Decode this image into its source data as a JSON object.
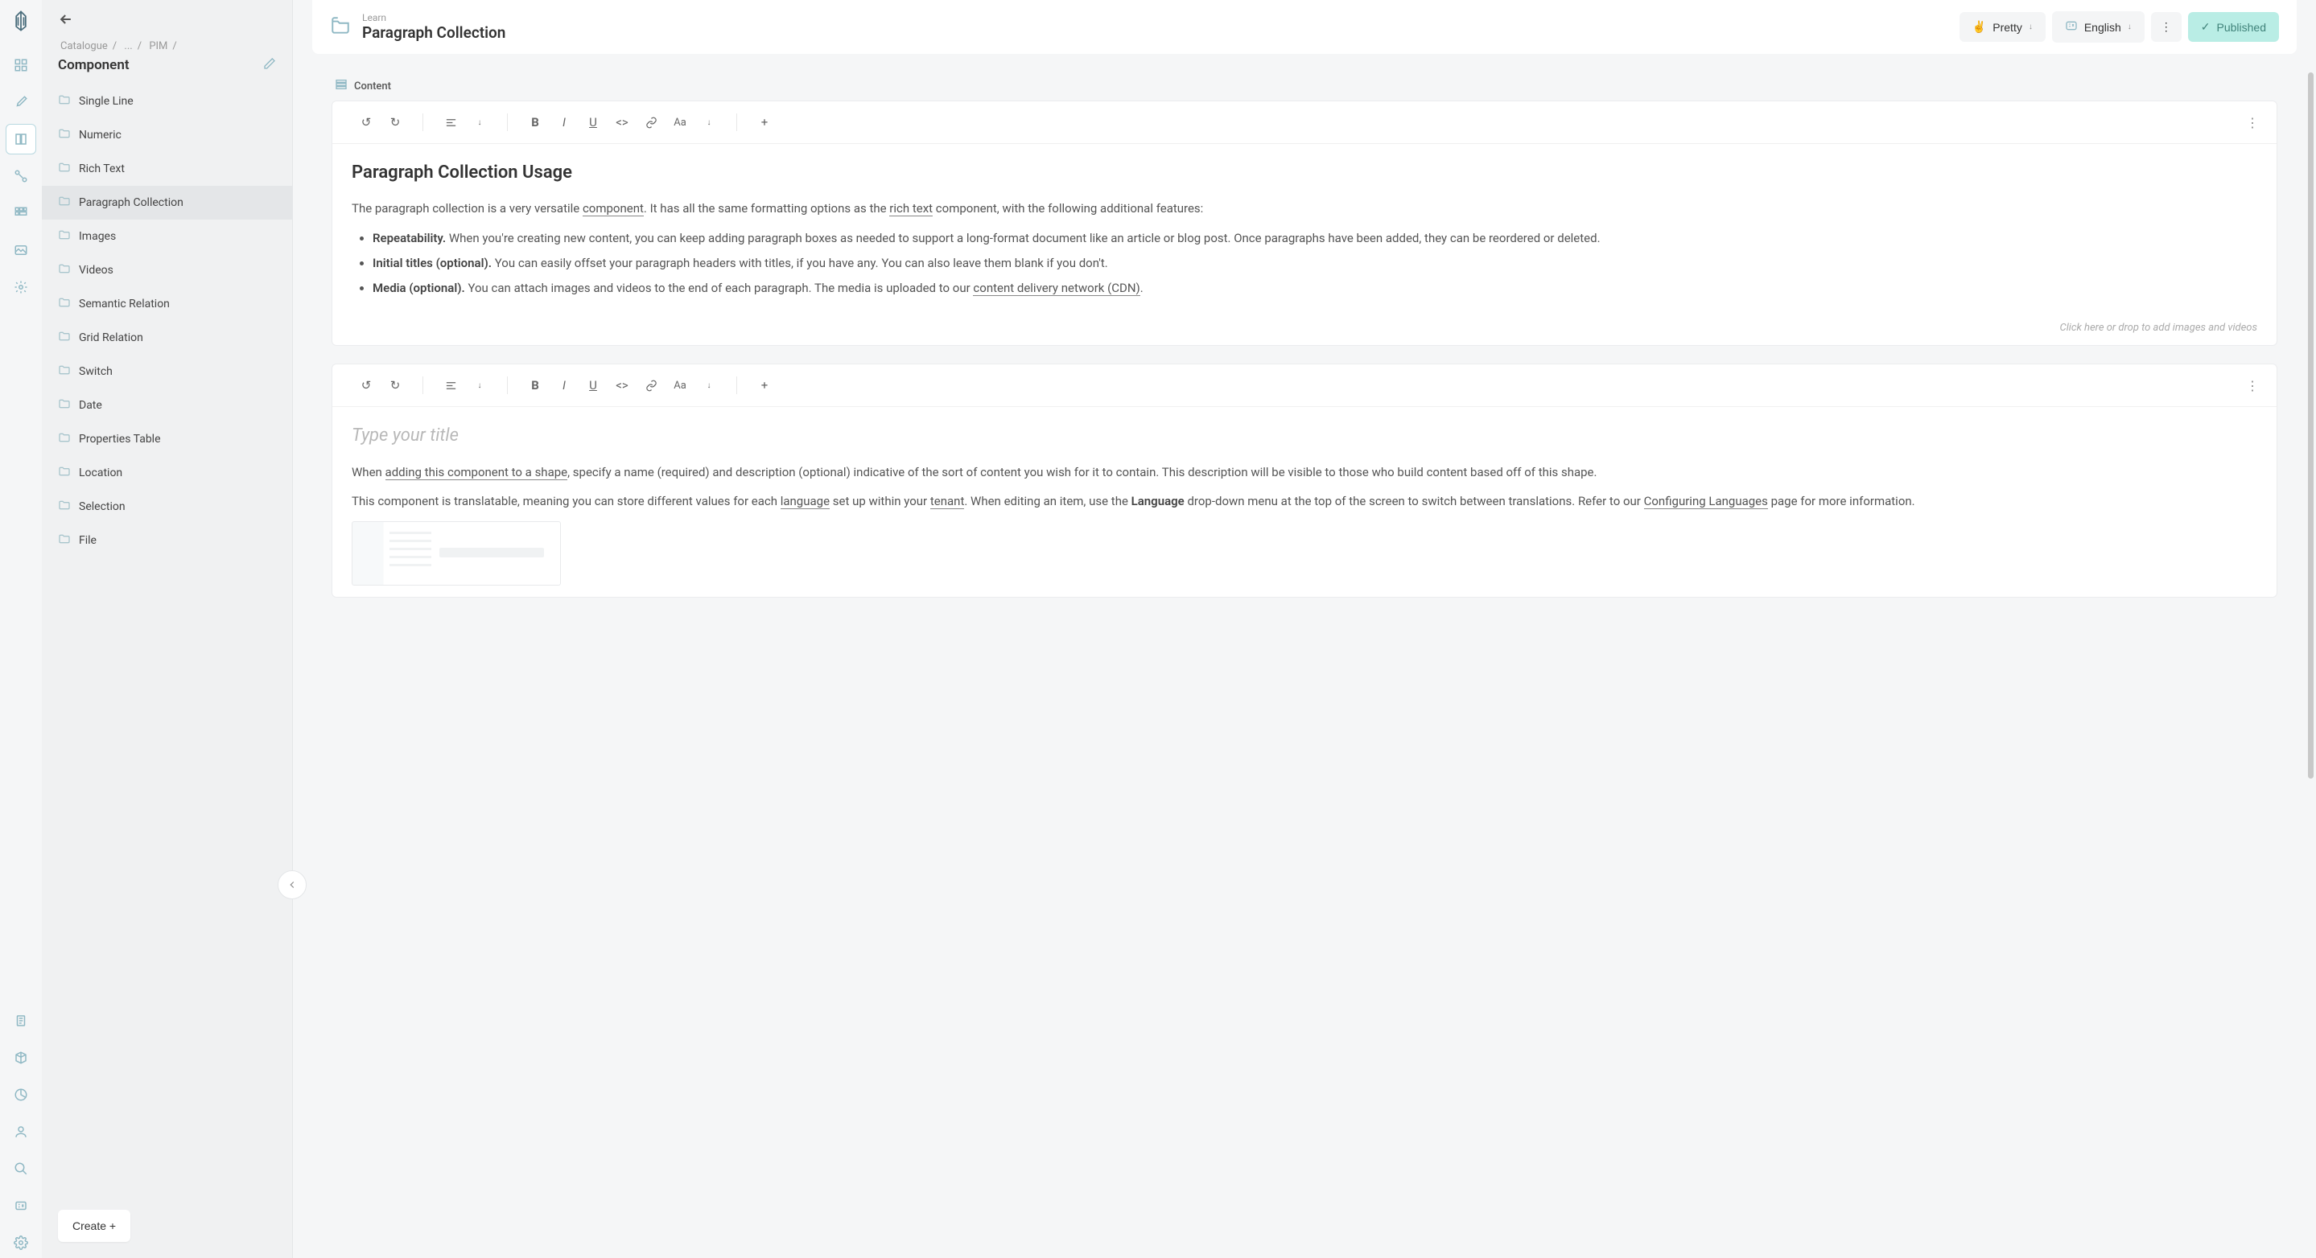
{
  "rail": {
    "icons": [
      "dashboard",
      "brush",
      "book",
      "graph",
      "grid",
      "image",
      "gear"
    ],
    "bottom": [
      "clipboard",
      "box",
      "pie",
      "user",
      "search",
      "language",
      "settings"
    ]
  },
  "sidebar": {
    "breadcrumb": [
      "Catalogue",
      "...",
      "PIM"
    ],
    "title": "Component",
    "items": [
      {
        "label": "Single Line"
      },
      {
        "label": "Numeric"
      },
      {
        "label": "Rich Text"
      },
      {
        "label": "Paragraph Collection"
      },
      {
        "label": "Images"
      },
      {
        "label": "Videos"
      },
      {
        "label": "Semantic Relation"
      },
      {
        "label": "Grid Relation"
      },
      {
        "label": "Switch"
      },
      {
        "label": "Date"
      },
      {
        "label": "Properties Table"
      },
      {
        "label": "Location"
      },
      {
        "label": "Selection"
      },
      {
        "label": "File"
      }
    ],
    "selected_index": 3,
    "create_label": "Create +"
  },
  "header": {
    "eyebrow": "Learn",
    "title": "Paragraph Collection",
    "pretty_label": "Pretty",
    "language_label": "English",
    "status_label": "Published"
  },
  "section_label": "Content",
  "paragraphs": [
    {
      "title": "Paragraph Collection Usage",
      "intro_pre": "The paragraph collection is a very versatile ",
      "link1": "component",
      "intro_mid": ". It has all the same formatting options as the ",
      "link2": "rich text",
      "intro_post": " component, with the following additional features:",
      "bullets": [
        {
          "strong": "Repeatability.",
          "text": " When you're creating new content, you can keep adding paragraph boxes as needed to support a long-format document like an article or blog post. Once paragraphs have been added, they can be reordered or deleted."
        },
        {
          "strong": "Initial titles (optional).",
          "text": " You can easily offset your paragraph headers with titles, if you have any. You can also leave them blank if you don't."
        },
        {
          "strong": "Media (optional).",
          "text_pre": " You can attach images and videos to the end of each paragraph. The media is uploaded to our ",
          "link": "content delivery network (CDN)",
          "text_post": "."
        }
      ],
      "dropzone": "Click here or drop to add images and videos"
    },
    {
      "title_placeholder": "Type your title",
      "p1_pre": "When ",
      "p1_link1": "adding this component to a shape",
      "p1_post": ", specify a name (required) and description (optional) indicative of the sort of content you wish for it to contain. This description will be visible to those who build content based off of this shape.",
      "p2_pre": "This component is translatable, meaning you can store different values for each ",
      "p2_link1": "language",
      "p2_mid1": " set up within your ",
      "p2_link2": "tenant",
      "p2_mid2": ". When editing an item, use the ",
      "p2_strong": "Language",
      "p2_mid3": " drop-down menu at the top of the screen to switch between translations. Refer to our ",
      "p2_link3": "Configuring Languages",
      "p2_post": " page for more information."
    }
  ]
}
